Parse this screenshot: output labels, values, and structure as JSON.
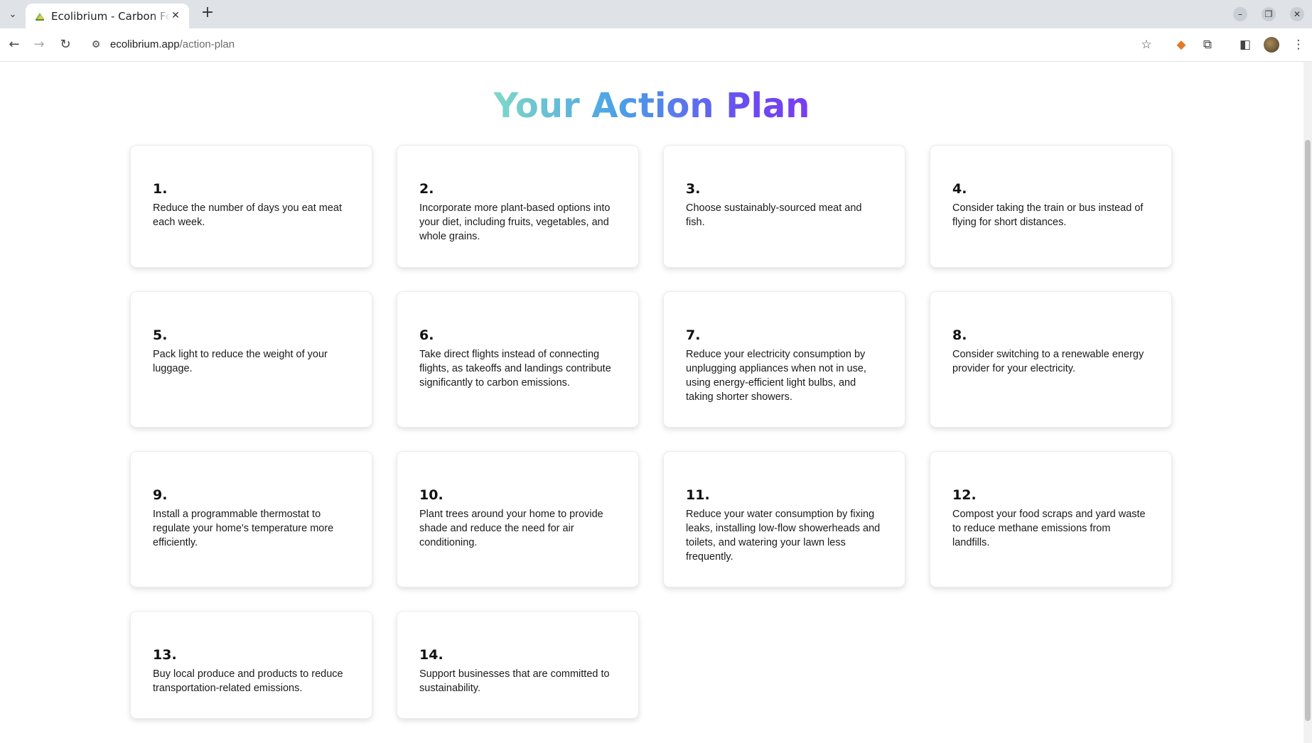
{
  "browser": {
    "tab_title": "Ecolibrium - Carbon Footprint",
    "url_host": "ecolibrium.app",
    "url_path": "/action-plan"
  },
  "page": {
    "title": "Your Action Plan",
    "actions": [
      {
        "number": "1.",
        "text": "Reduce the number of days you eat meat each week."
      },
      {
        "number": "2.",
        "text": "Incorporate more plant-based options into your diet, including fruits, vegetables, and whole grains."
      },
      {
        "number": "3.",
        "text": "Choose sustainably-sourced meat and fish."
      },
      {
        "number": "4.",
        "text": "Consider taking the train or bus instead of flying for short distances."
      },
      {
        "number": "5.",
        "text": "Pack light to reduce the weight of your luggage."
      },
      {
        "number": "6.",
        "text": "Take direct flights instead of connecting flights, as takeoffs and landings contribute significantly to carbon emissions."
      },
      {
        "number": "7.",
        "text": "Reduce your electricity consumption by unplugging appliances when not in use, using energy-efficient light bulbs, and taking shorter showers."
      },
      {
        "number": "8.",
        "text": "Consider switching to a renewable energy provider for your electricity."
      },
      {
        "number": "9.",
        "text": "Install a programmable thermostat to regulate your home's temperature more efficiently."
      },
      {
        "number": "10.",
        "text": "Plant trees around your home to provide shade and reduce the need for air conditioning."
      },
      {
        "number": "11.",
        "text": "Reduce your water consumption by fixing leaks, installing low-flow showerheads and toilets, and watering your lawn less frequently."
      },
      {
        "number": "12.",
        "text": "Compost your food scraps and yard waste to reduce methane emissions from landfills."
      },
      {
        "number": "13.",
        "text": "Buy local produce and products to reduce transportation-related emissions."
      },
      {
        "number": "14.",
        "text": "Support businesses that are committed to sustainability."
      }
    ]
  },
  "colors": {
    "title_gradient": [
      "#7fd8c8",
      "#4aa0e8",
      "#6a4cf0",
      "#7a3cf0"
    ]
  }
}
